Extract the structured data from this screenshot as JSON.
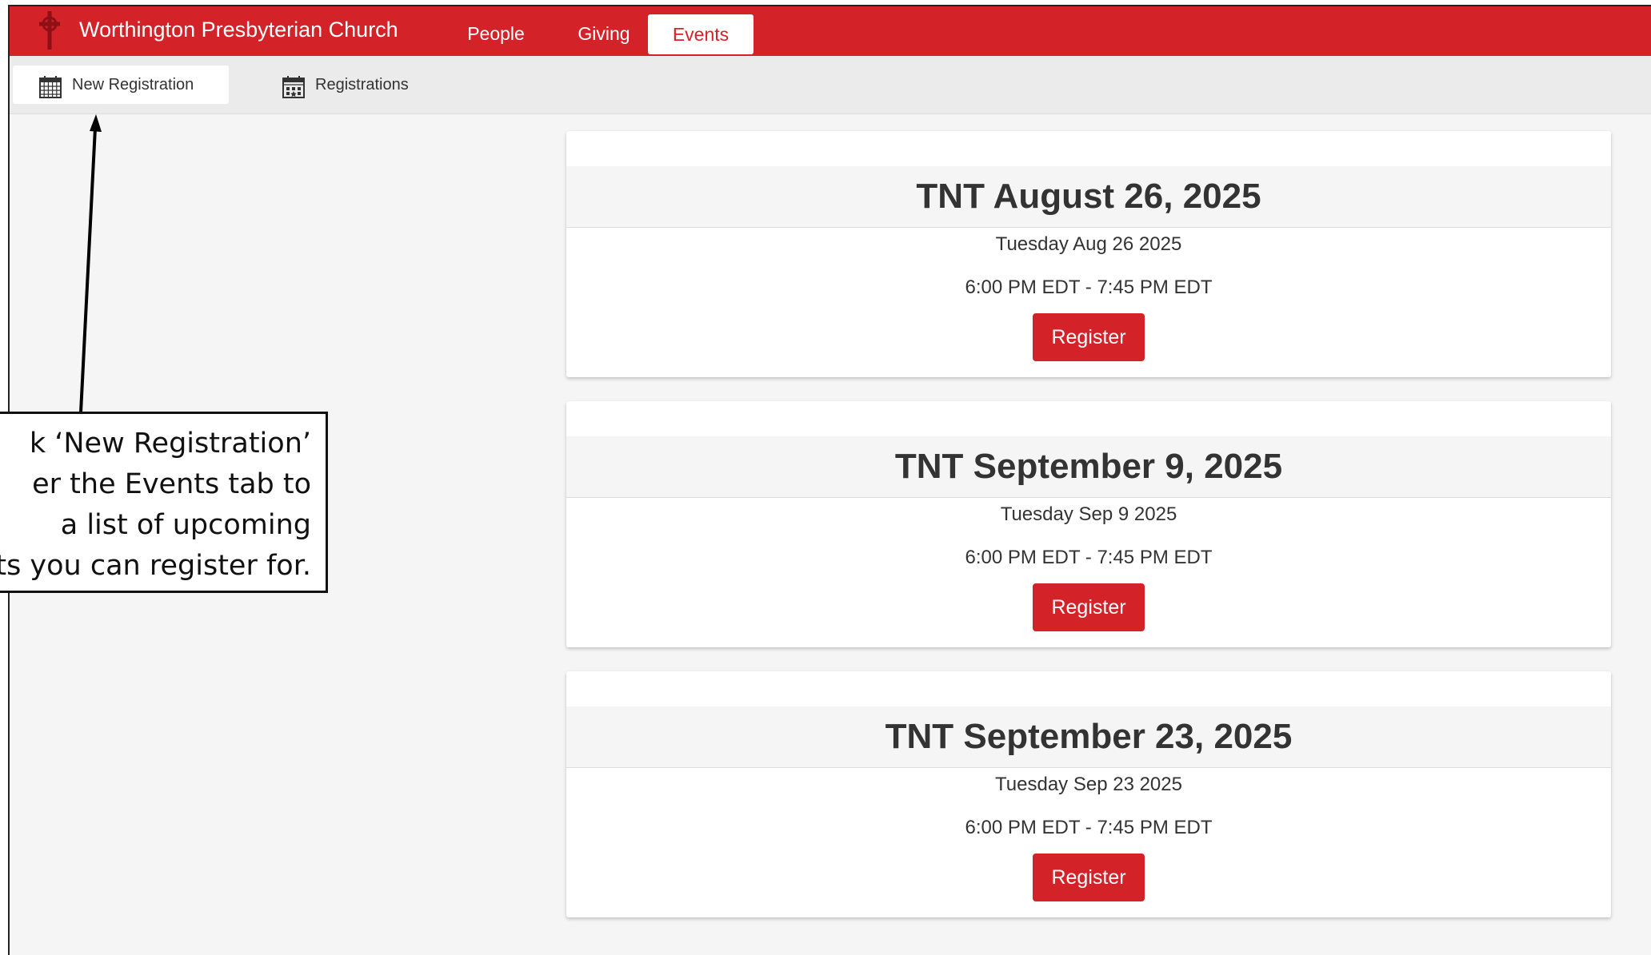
{
  "header": {
    "brand": "Worthington Presbyterian Church",
    "logo_icon": "celtic-cross-icon",
    "nav": [
      {
        "label": "People",
        "active": false
      },
      {
        "label": "Giving",
        "active": false
      },
      {
        "label": "Events",
        "active": true
      }
    ]
  },
  "subnav": {
    "items": [
      {
        "label": "New Registration",
        "icon": "calendar-grid-icon",
        "active": true
      },
      {
        "label": "Registrations",
        "icon": "calendar-event-icon",
        "active": false
      }
    ]
  },
  "events": [
    {
      "title": "TNT August 26, 2025",
      "date": "Tuesday Aug 26 2025",
      "time": "6:00 PM EDT - 7:45 PM EDT",
      "button": "Register"
    },
    {
      "title": "TNT September 9, 2025",
      "date": "Tuesday Sep 9 2025",
      "time": "6:00 PM EDT - 7:45 PM EDT",
      "button": "Register"
    },
    {
      "title": "TNT September 23, 2025",
      "date": "Tuesday Sep 23 2025",
      "time": "6:00 PM EDT - 7:45 PM EDT",
      "button": "Register"
    }
  ],
  "annotation": {
    "lines": [
      "k ‘New Registration’",
      "er the Events tab to",
      "a list of upcoming",
      "ts you can register for."
    ]
  },
  "colors": {
    "brand_red": "#d42229",
    "background": "#f5f5f5",
    "text": "#333333"
  }
}
